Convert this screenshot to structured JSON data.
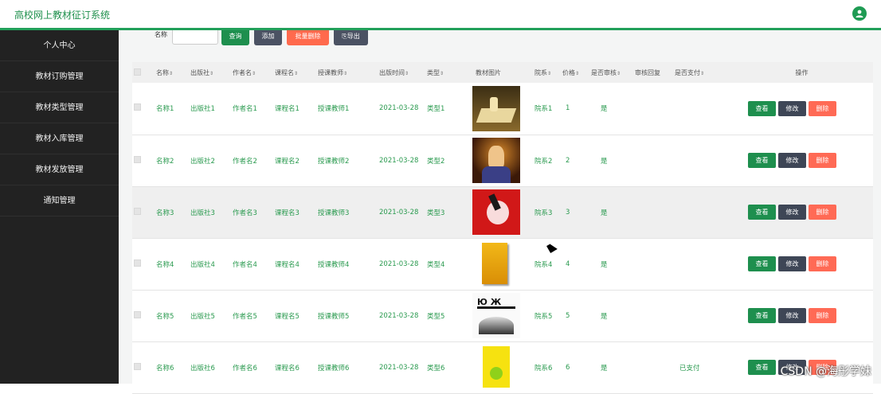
{
  "app_title": "高校网上教材征订系统",
  "sidebar": {
    "items": [
      {
        "label": "个人中心"
      },
      {
        "label": "教材订购管理"
      },
      {
        "label": "教材类型管理"
      },
      {
        "label": "教材入库管理"
      },
      {
        "label": "教材发放管理"
      },
      {
        "label": "通知管理"
      }
    ]
  },
  "toolbar": {
    "search_label": "名称",
    "search_value": "",
    "query_label": "查询",
    "add_label": "添加",
    "batch_delete_label": "批量删除",
    "export_label": "导出"
  },
  "table": {
    "headers": {
      "name": "名称",
      "publisher": "出版社",
      "author": "作者名",
      "course": "课程名",
      "teacher": "授课教师",
      "date": "出版时间",
      "type": "类型",
      "image": "教材图片",
      "dept": "院系",
      "price": "价格",
      "reviewed": "是否审核",
      "reply": "审核回复",
      "paid": "是否支付",
      "actions": "操作"
    },
    "sort_glyph": "⇕",
    "rows": [
      {
        "name": "名称1",
        "publisher": "出版社1",
        "author": "作者名1",
        "course": "课程名1",
        "teacher": "授课教师1",
        "date": "2021-03-28",
        "type": "类型1",
        "dept": "院系1",
        "price": "1",
        "reviewed": "是",
        "reply": "",
        "paid": ""
      },
      {
        "name": "名称2",
        "publisher": "出版社2",
        "author": "作者名2",
        "course": "课程名2",
        "teacher": "授课教师2",
        "date": "2021-03-28",
        "type": "类型2",
        "dept": "院系2",
        "price": "2",
        "reviewed": "是",
        "reply": "",
        "paid": ""
      },
      {
        "name": "名称3",
        "publisher": "出版社3",
        "author": "作者名3",
        "course": "课程名3",
        "teacher": "授课教师3",
        "date": "2021-03-28",
        "type": "类型3",
        "dept": "院系3",
        "price": "3",
        "reviewed": "是",
        "reply": "",
        "paid": ""
      },
      {
        "name": "名称4",
        "publisher": "出版社4",
        "author": "作者名4",
        "course": "课程名4",
        "teacher": "授课教师4",
        "date": "2021-03-28",
        "type": "类型4",
        "dept": "院系4",
        "price": "4",
        "reviewed": "是",
        "reply": "",
        "paid": ""
      },
      {
        "name": "名称5",
        "publisher": "出版社5",
        "author": "作者名5",
        "course": "课程名5",
        "teacher": "授课教师5",
        "date": "2021-03-28",
        "type": "类型5",
        "dept": "院系5",
        "price": "5",
        "reviewed": "是",
        "reply": "",
        "paid": ""
      },
      {
        "name": "名称6",
        "publisher": "出版社6",
        "author": "作者名6",
        "course": "课程名6",
        "teacher": "授课教师6",
        "date": "2021-03-28",
        "type": "类型6",
        "dept": "院系6",
        "price": "6",
        "reviewed": "是",
        "reply": "",
        "paid": "已支付"
      }
    ],
    "actions": {
      "view": "查看",
      "edit": "修改",
      "delete": "删除"
    }
  },
  "watermark": "CSDN @海彤学妹",
  "colors": {
    "brand_green": "#1e8f4e",
    "sidebar_bg": "#222222",
    "danger": "#ff6a55",
    "dark_button": "#3e4656"
  }
}
